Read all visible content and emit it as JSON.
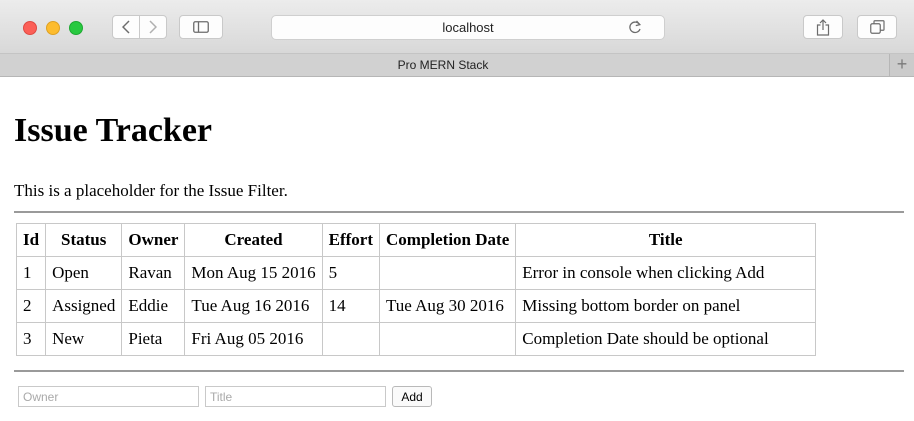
{
  "browser": {
    "address": "localhost",
    "tab_title": "Pro MERN Stack",
    "new_tab_symbol": "+",
    "icons": [
      "back-icon",
      "forward-icon",
      "sidebar-icon",
      "reload-icon",
      "share-icon",
      "tabs-overview-icon"
    ]
  },
  "page": {
    "title": "Issue Tracker",
    "filter_placeholder": "This is a placeholder for the Issue Filter."
  },
  "table": {
    "headers": [
      "Id",
      "Status",
      "Owner",
      "Created",
      "Effort",
      "Completion Date",
      "Title"
    ],
    "rows": [
      [
        "1",
        "Open",
        "Ravan",
        "Mon Aug 15 2016",
        "5",
        "",
        "Error in console when clicking Add"
      ],
      [
        "2",
        "Assigned",
        "Eddie",
        "Tue Aug 16 2016",
        "14",
        "Tue Aug 30 2016",
        "Missing bottom border on panel"
      ],
      [
        "3",
        "New",
        "Pieta",
        "Fri Aug 05 2016",
        "",
        "",
        "Completion Date should be optional"
      ]
    ]
  },
  "add_form": {
    "owner_placeholder": "Owner",
    "title_placeholder": "Title",
    "add_label": "Add"
  }
}
